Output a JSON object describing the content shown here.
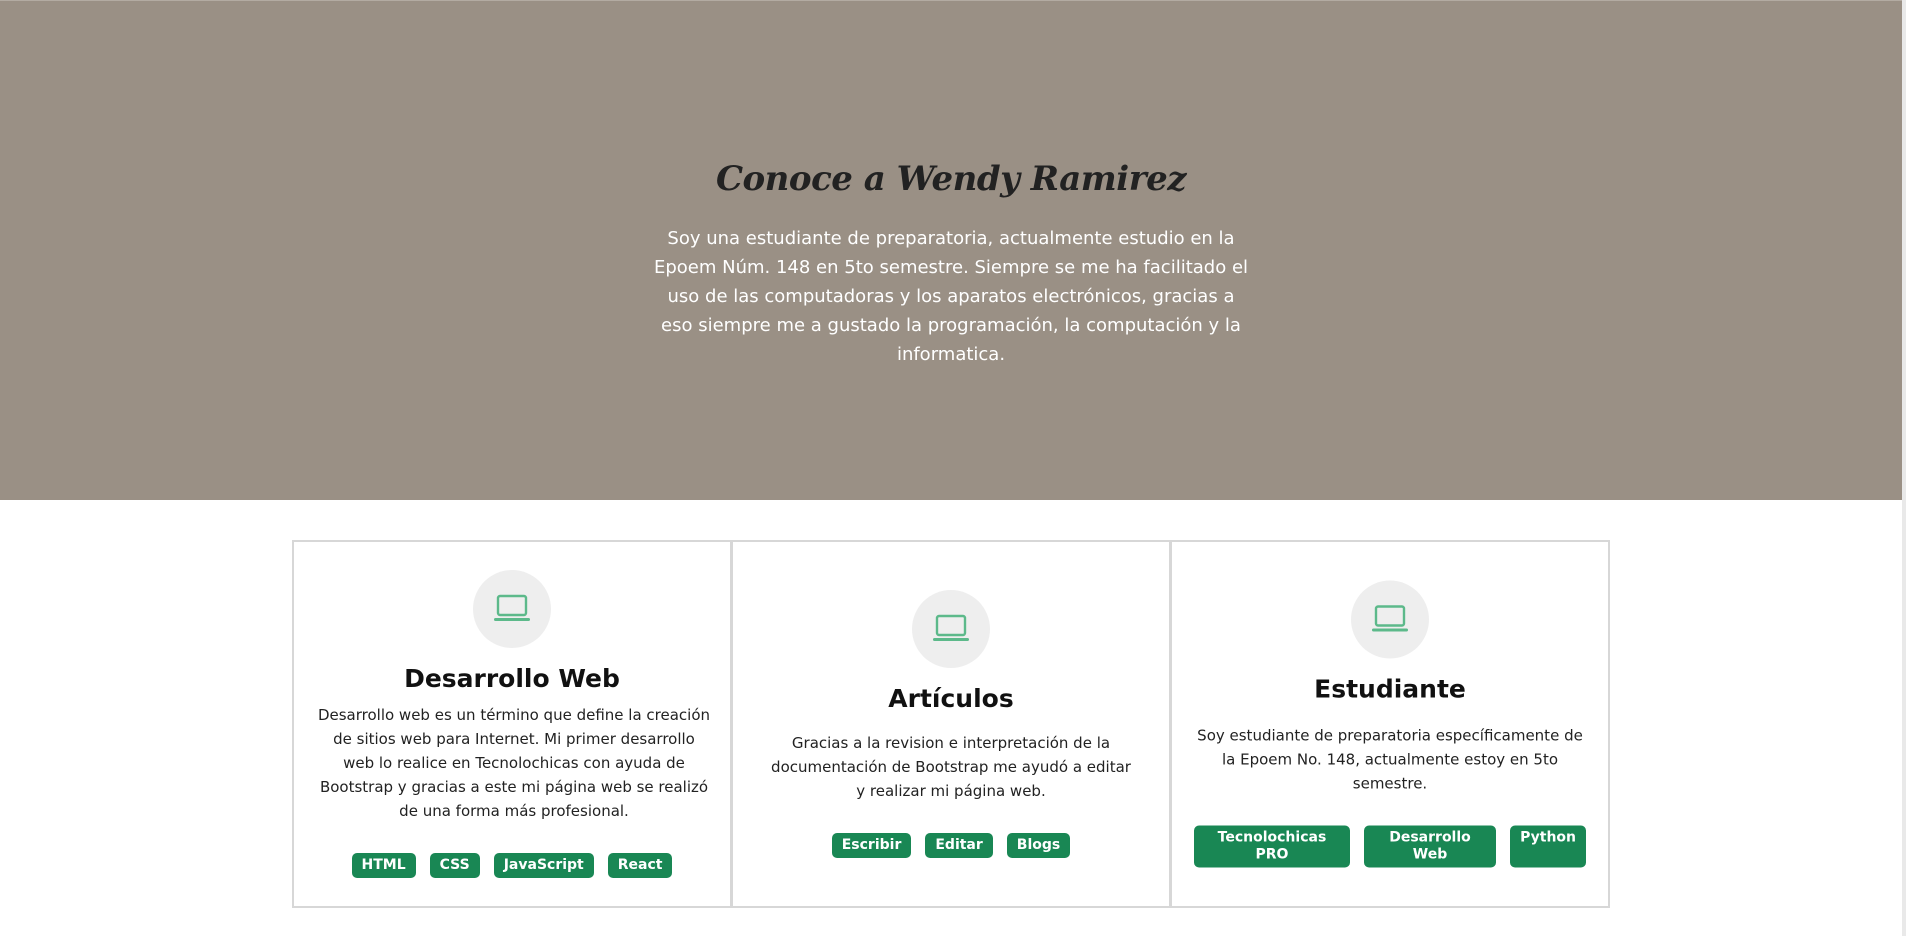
{
  "hero": {
    "title": "Conoce a Wendy Ramirez",
    "text": "Soy una estudiante de preparatoria, actualmente estudio en la Epoem Núm. 148 en 5to semestre. Siempre se me ha facilitado el uso de las computadoras y los aparatos electrónicos, gracias a eso siempre me a gustado la programación, la computación y la informatica.",
    "background_color": "#9a9085"
  },
  "cards": [
    {
      "icon": "laptop-icon",
      "title": "Desarrollo Web",
      "text": "Desarrollo web es un término que define la creación de sitios web para Internet. Mi primer desarrollo web lo realice en Tecnolochicas con ayuda de Bootstrap y gracias a este mi página web se realizó de una forma más profesional.",
      "tags": [
        "HTML",
        "CSS",
        "JavaScript",
        "React"
      ]
    },
    {
      "icon": "laptop-icon",
      "title": "Artículos",
      "text": "Gracias a la revision e interpretación de la documentación de Bootstrap me ayudó a editar y realizar mi página web.",
      "tags": [
        "Escribir",
        "Editar",
        "Blogs"
      ]
    },
    {
      "icon": "laptop-icon",
      "title": "Estudiante",
      "text": "Soy estudiante de preparatoria específicamente de la Epoem No. 148, actualmente estoy en 5to semestre.",
      "tags": [
        "Tecnolochicas PRO",
        "Desarrollo Web",
        "Python"
      ]
    }
  ],
  "colors": {
    "accent": "#198754",
    "icon": "#5cb98a",
    "icon_bg": "#eeeeee"
  }
}
